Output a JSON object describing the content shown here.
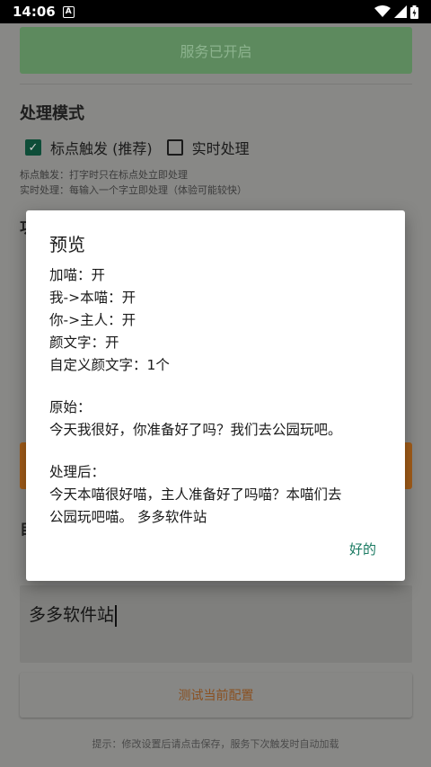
{
  "status_bar": {
    "time": "14:06"
  },
  "page": {
    "service_button_label": "服务已开启",
    "mode_section_title": "处理模式",
    "option_punct_label": "标点触发 (推荐)",
    "option_realtime_label": "实时处理",
    "desc_punct": "标点触发：打字时只在标点处立即处理",
    "desc_realtime": "实时处理：每输入一个字立即处理（体验可能较快）",
    "test_input_value": "多多软件站",
    "test_button_label": "测试当前配置",
    "hint": "提示：修改设置后请点击保存，服务下次触发时自动加载"
  },
  "dialog": {
    "title": "预览",
    "line1": "加喵：开",
    "line2": "我->本喵：开",
    "line3": "你->主人：开",
    "line4": "颜文字：开",
    "line5": "自定义颜文字：1个",
    "original_label": "原始：",
    "original_text": "今天我很好，你准备好了吗？我们去公园玩吧。",
    "processed_label": "处理后：",
    "processed_line1": "今天本喵很好喵，主人准备好了吗喵？本喵们去",
    "processed_line2": "公园玩吧喵。 多多软件站",
    "ok_label": "好的"
  }
}
